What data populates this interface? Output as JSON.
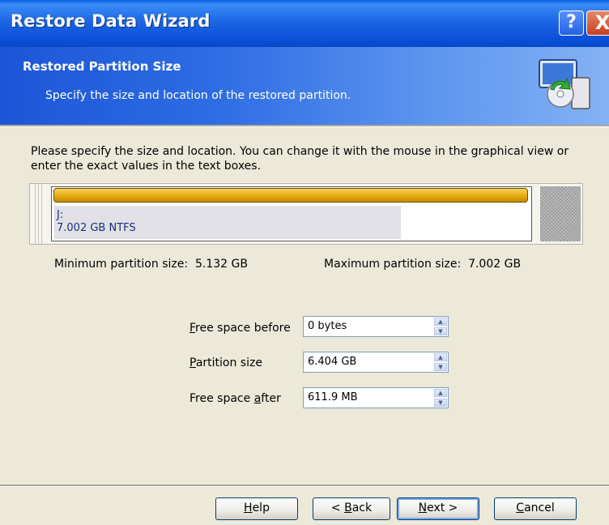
{
  "window": {
    "title": "Restore Data Wizard",
    "help_glyph": "?",
    "close_glyph": "X"
  },
  "header": {
    "title": "Restored Partition Size",
    "subtitle": "Specify the size and location of the restored partition.",
    "icon": "restore-disk-icon"
  },
  "instructions": "Please specify the size and location. You can change it with the mouse in the graphical view or enter the exact values in the text boxes.",
  "partition": {
    "drive_letter": "J:",
    "size_fs": "7.002 GB  NTFS",
    "bar_color": "#e3ab0f",
    "used_fraction": 0.73
  },
  "limits": {
    "min_label": "Minimum partition size:",
    "min_value": "5.132 GB",
    "max_label": "Maximum partition size:",
    "max_value": "7.002 GB"
  },
  "fields": {
    "free_before": {
      "mnemonic": "F",
      "rest": "ree space before",
      "value": "0 bytes"
    },
    "partition_size": {
      "mnemonic": "P",
      "rest": "artition size",
      "value": "6.404 GB"
    },
    "free_after": {
      "prefix": "Free space ",
      "mnemonic": "a",
      "rest": "fter",
      "value": "611.9 MB"
    }
  },
  "buttons": {
    "help": {
      "mnemonic": "H",
      "rest": "elp"
    },
    "back": {
      "prefix": "< ",
      "mnemonic": "B",
      "rest": "ack"
    },
    "next": {
      "mnemonic": "N",
      "rest": "ext >"
    },
    "cancel": {
      "mnemonic": "C",
      "rest": "ancel"
    }
  }
}
